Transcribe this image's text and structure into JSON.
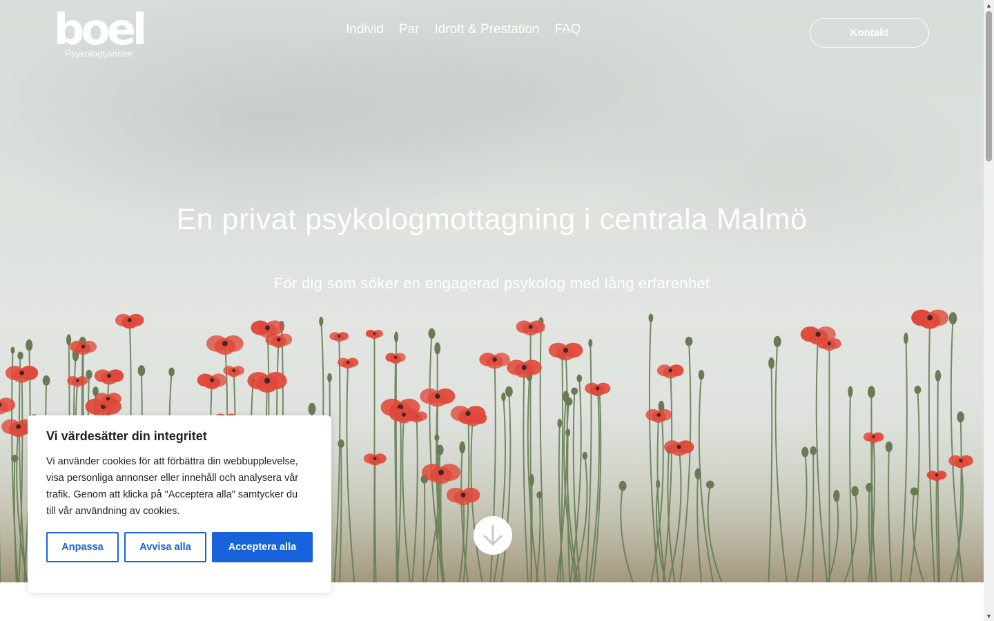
{
  "brand": {
    "logo_word": "boel",
    "logo_sub": "Psykologtjänster"
  },
  "nav": {
    "items": [
      {
        "label": "Individ"
      },
      {
        "label": "Par"
      },
      {
        "label": "Idrott & Prestation"
      },
      {
        "label": "FAQ"
      }
    ]
  },
  "header": {
    "contact_label": "Kontakt"
  },
  "hero": {
    "title": "En privat psykologmottagning i centrala Malmö",
    "subtitle": "För dig som söker en engagerad psykolog med lång erfarenhet",
    "scroll_icon": "arrow-down-icon"
  },
  "cookie": {
    "title": "Vi värdesätter din integritet",
    "text": "Vi använder cookies för att förbättra din webbupplevelse, visa personliga annonser eller innehåll och analysera vår trafik. Genom att klicka på \"Acceptera alla\" samtycker du till vår användning av cookies.",
    "customize_label": "Anpassa",
    "reject_label": "Avvisa alla",
    "accept_label": "Acceptera alla"
  },
  "colors": {
    "accent": "#1863dc",
    "poppy": "#e0483a",
    "stem": "#5f7a4f",
    "sky": "#dfe3de"
  }
}
